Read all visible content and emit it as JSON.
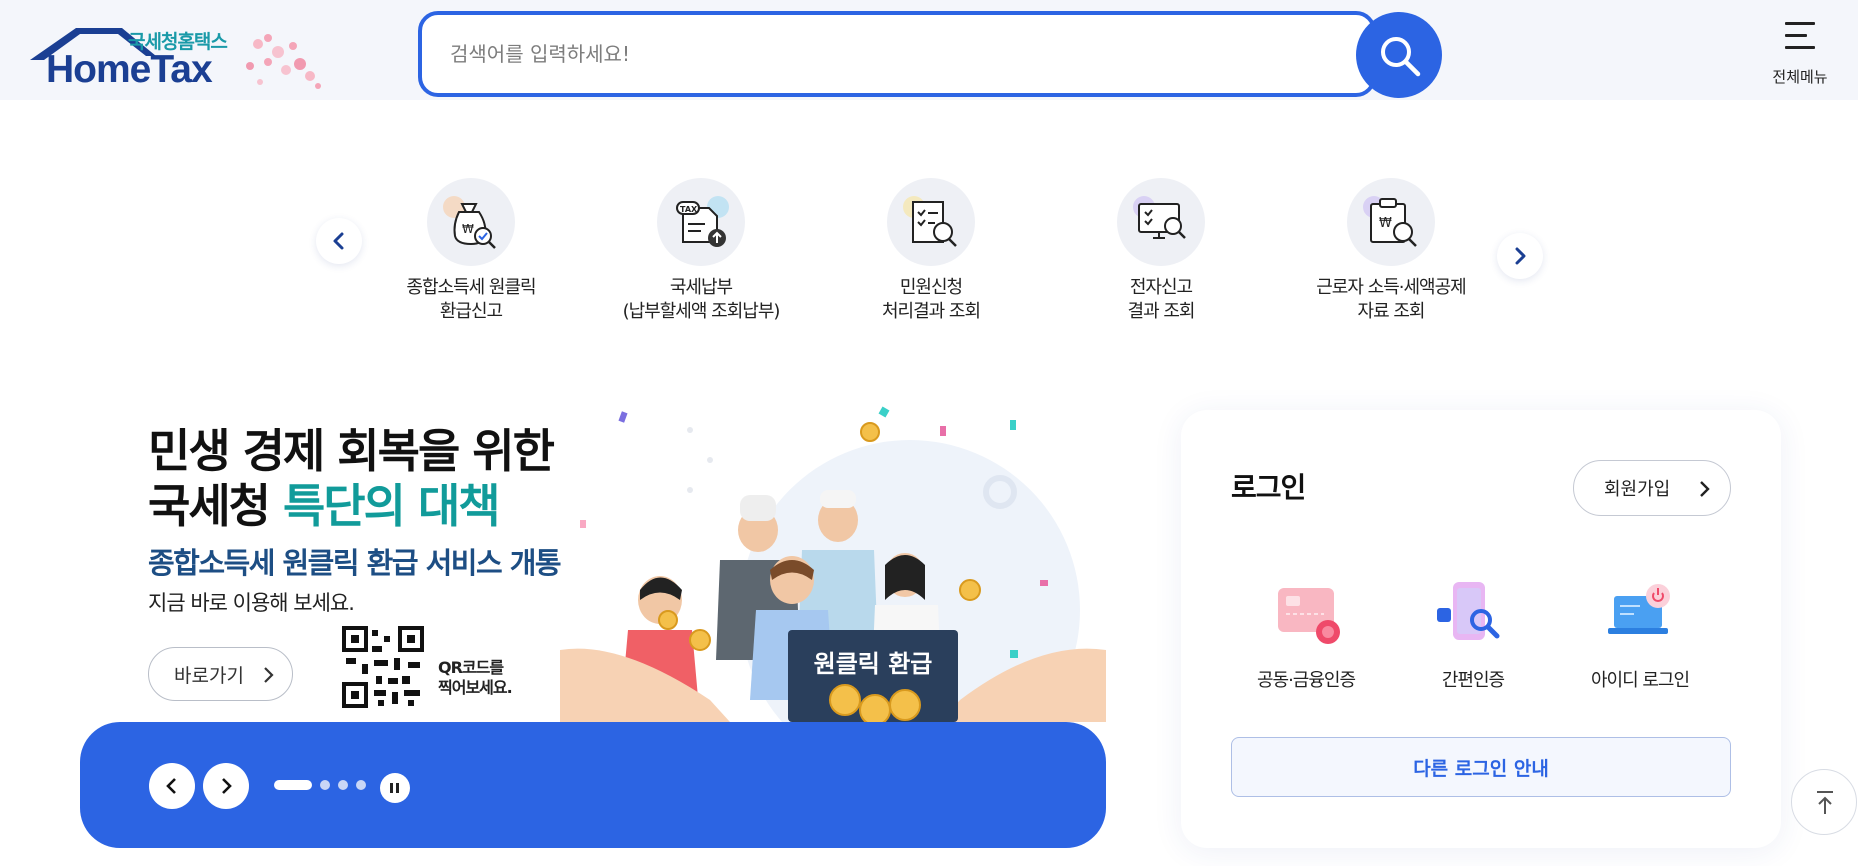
{
  "header": {
    "logo_sub": "국세청홈택스",
    "logo_main": "HomeTax",
    "search_placeholder": "검색어를 입력하세요!",
    "menu_label": "전체메뉴"
  },
  "quick_menu": {
    "items": [
      {
        "line1": "종합소득세 원클릭",
        "line2": "환급신고",
        "icon": "money-bag-search-icon"
      },
      {
        "line1": "국세납부",
        "line2": "(납부할세액 조회납부)",
        "icon": "tax-document-upload-icon"
      },
      {
        "line1": "민원신청",
        "line2": "처리결과 조회",
        "icon": "document-search-icon"
      },
      {
        "line1": "전자신고",
        "line2": "결과 조회",
        "icon": "monitor-search-icon"
      },
      {
        "line1": "근로자 소득·세액공제",
        "line2": "자료 조회",
        "icon": "clipboard-search-icon"
      }
    ]
  },
  "banner": {
    "title_line1": "민생 경제 회복을 위한",
    "title_line2_plain": "국세청 ",
    "title_line2_accent": "특단의 대책",
    "subtitle": "종합소득세 원클릭 환급 서비스 개통",
    "description": "지금 바로 이용해 보세요.",
    "go_button": "바로가기",
    "qr_text_line1": "QR코드를",
    "qr_text_line2": "찍어보세요.",
    "sign_text": "원클릭 환급",
    "slide_count": 4,
    "active_slide": 1
  },
  "login": {
    "title": "로그인",
    "join_button": "회원가입",
    "options": [
      {
        "label": "공동·금융인증",
        "icon": "certificate-card-icon"
      },
      {
        "label": "간편인증",
        "icon": "phone-search-icon"
      },
      {
        "label": "아이디 로그인",
        "icon": "laptop-power-icon"
      }
    ],
    "other_login": "다른 로그인 안내"
  },
  "colors": {
    "primary": "#2c64e3",
    "brand_navy": "#1b3f93",
    "accent_teal": "#119b9a",
    "subtitle_blue": "#1d4e84"
  }
}
